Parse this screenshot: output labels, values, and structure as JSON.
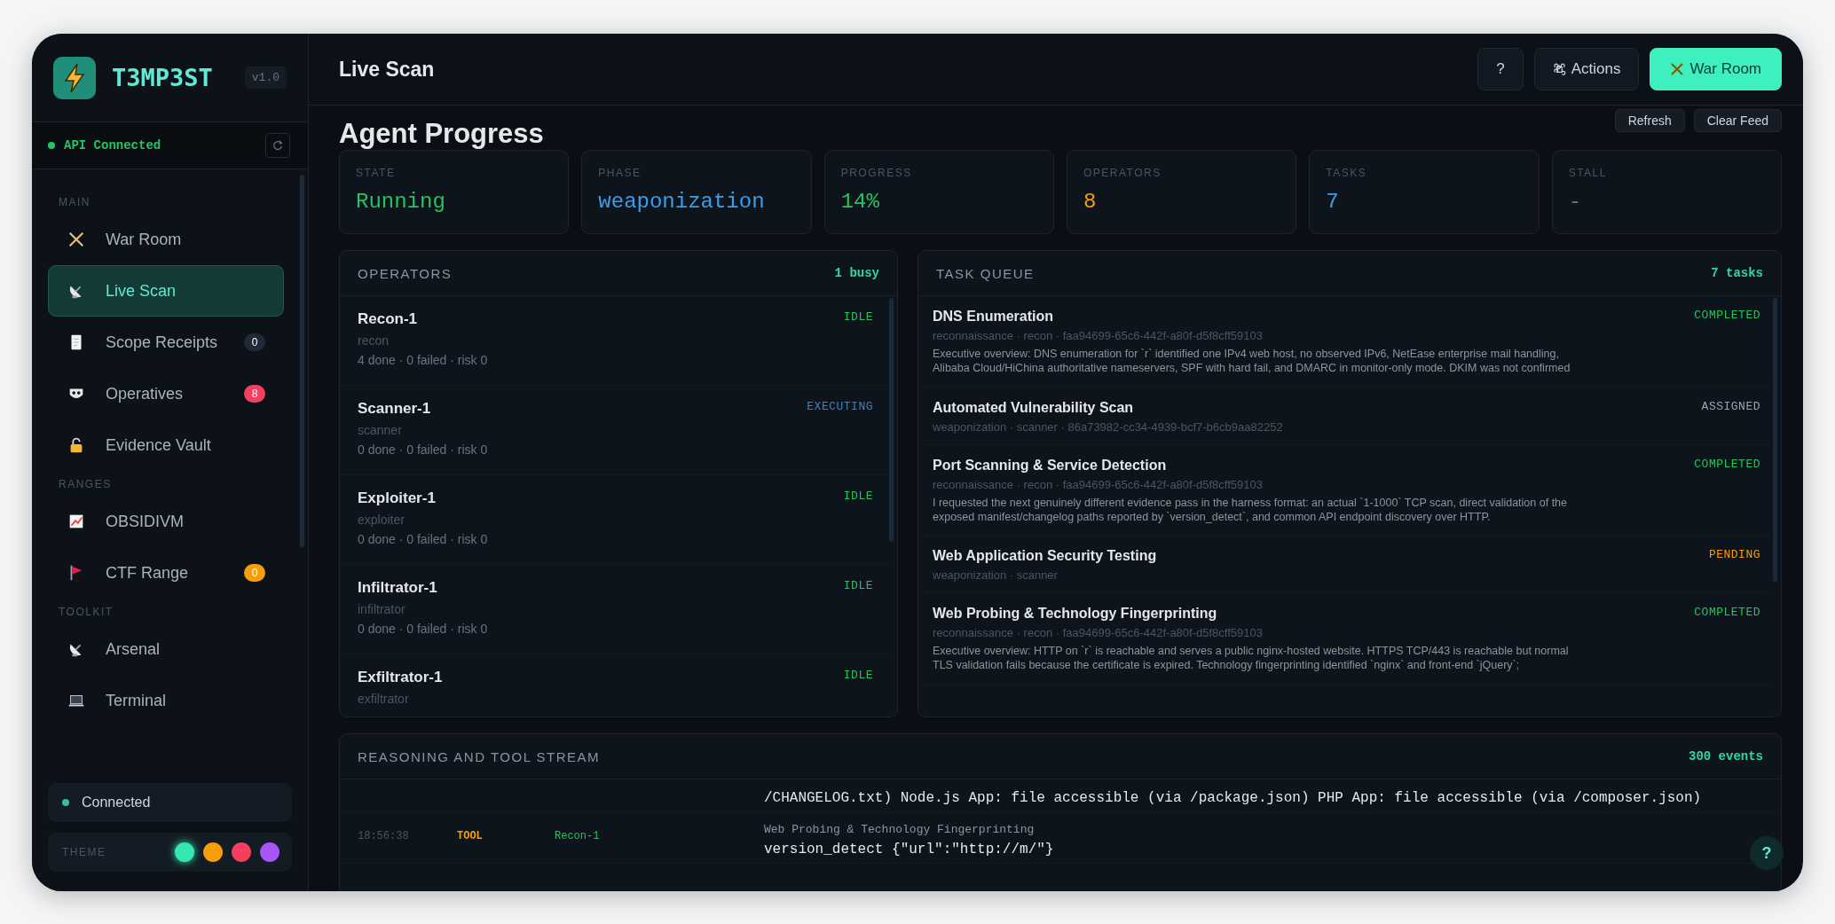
{
  "sidebar": {
    "logo": "T3MP3ST",
    "version": "v1.0",
    "api_status": "API Connected",
    "sections": [
      {
        "label": "MAIN",
        "items": [
          {
            "label": "War Room",
            "selected": false
          },
          {
            "label": "Live Scan",
            "selected": true
          },
          {
            "label": "Scope Receipts",
            "selected": false,
            "badge": "0",
            "color": "#1f2937"
          },
          {
            "label": "Operatives",
            "selected": false,
            "badge": "8",
            "color": "#f43f5e"
          },
          {
            "label": "Evidence Vault",
            "selected": false
          }
        ]
      },
      {
        "label": "RANGES",
        "items": [
          {
            "label": "OBSIDIVM",
            "selected": false
          },
          {
            "label": "CTF Range",
            "selected": false,
            "badge": "0",
            "color": "#f59e0b"
          }
        ]
      },
      {
        "label": "TOOLKIT",
        "items": [
          {
            "label": "Arsenal",
            "selected": false
          },
          {
            "label": "Terminal",
            "selected": false
          }
        ]
      }
    ],
    "connection": "Connected",
    "theme": {
      "label": "THEME",
      "swatches": [
        {
          "color": "#34e8b0",
          "selected": true
        },
        {
          "color": "#f59e0b",
          "selected": false
        },
        {
          "color": "#f43f5e",
          "selected": false
        },
        {
          "color": "#a855f7",
          "selected": false
        }
      ]
    }
  },
  "header": {
    "title": "Live Scan",
    "help": "?",
    "actions": "Actions",
    "war_room": "War Room"
  },
  "section_title": "Agent Progress",
  "section_buttons": [
    "Refresh",
    "Clear Feed"
  ],
  "stats": [
    {
      "label": "STATE",
      "value": "Running",
      "color": "#22c55e"
    },
    {
      "label": "PHASE",
      "value": "weaponization",
      "color": "#3b9eea"
    },
    {
      "label": "PROGRESS",
      "value": "14%",
      "color": "#22c55e"
    },
    {
      "label": "OPERATORS",
      "value": "8",
      "color": "#f59e0b"
    },
    {
      "label": "TASKS",
      "value": "7",
      "color": "#3b9eea"
    },
    {
      "label": "STALL",
      "value": "-",
      "color": "#6b7280"
    }
  ],
  "operators": {
    "title": "OPERATORS",
    "count": "1 busy",
    "rows": [
      {
        "name": "Recon-1",
        "role": "recon",
        "stats": "4 done · 0 failed · risk 0",
        "status": "IDLE",
        "kind": "idle"
      },
      {
        "name": "Scanner-1",
        "role": "scanner",
        "stats": "0 done · 0 failed · risk 0",
        "status": "EXECUTING",
        "kind": "executing"
      },
      {
        "name": "Exploiter-1",
        "role": "exploiter",
        "stats": "0 done · 0 failed · risk 0",
        "status": "IDLE",
        "kind": "idle"
      },
      {
        "name": "Infiltrator-1",
        "role": "infiltrator",
        "stats": "0 done · 0 failed · risk 0",
        "status": "IDLE",
        "kind": "idle"
      },
      {
        "name": "Exfiltrator-1",
        "role": "exfiltrator",
        "status": "IDLE",
        "kind": "idle"
      }
    ]
  },
  "task_queue": {
    "title": "TASK QUEUE",
    "count": "7 tasks",
    "rows": [
      {
        "title": "DNS Enumeration",
        "meta": "reconnaissance · recon · faa94699-65c6-442f-a80f-d5f8cff59103",
        "summary": "Executive overview: DNS enumeration for `r` identified one IPv4 web host, no observed IPv6, NetEase enterprise mail handling, Alibaba Cloud/HiChina authoritative nameservers, SPF with hard fail, and DMARC in monitor-only mode. DKIM was not confirmed",
        "status": "COMPLETED",
        "kind": "completed"
      },
      {
        "title": "Automated Vulnerability Scan",
        "meta": "weaponization · scanner · 86a73982-cc34-4939-bcf7-b6cb9aa82252",
        "status": "ASSIGNED",
        "kind": "assigned"
      },
      {
        "title": "Port Scanning & Service Detection",
        "meta": "reconnaissance · recon · faa94699-65c6-442f-a80f-d5f8cff59103",
        "summary": "I requested the next genuinely different evidence pass in the harness format: an actual `1-1000` TCP scan, direct validation of the exposed manifest/changelog paths reported by `version_detect`, and common API endpoint discovery over HTTP.",
        "status": "COMPLETED",
        "kind": "completed"
      },
      {
        "title": "Web Application Security Testing",
        "meta": "weaponization · scanner",
        "status": "PENDING",
        "kind": "pending"
      },
      {
        "title": "Web Probing & Technology Fingerprinting",
        "meta": "reconnaissance · recon · faa94699-65c6-442f-a80f-d5f8cff59103",
        "summary": "Executive overview: HTTP on `r` is reachable and serves a public nginx-hosted website. HTTPS TCP/443 is reachable but normal TLS validation fails because the certificate is expired. Technology fingerprinting identified `nginx` and front-end `jQuery`;",
        "status": "COMPLETED",
        "kind": "completed"
      }
    ]
  },
  "stream": {
    "title": "REASONING AND TOOL STREAM",
    "count": "300 events",
    "events": [
      {
        "detail": "/CHANGELOG.txt) Node.js App: file accessible (via /package.json) PHP App: file accessible (via /composer.json)"
      },
      {
        "time": "18:56:38",
        "type": "TOOL",
        "agent": "Recon-1",
        "title": "Web Probing & Technology Fingerprinting",
        "detail": "version_detect {\"url\":\"http://m/\"}"
      }
    ]
  },
  "help_fab": "?"
}
